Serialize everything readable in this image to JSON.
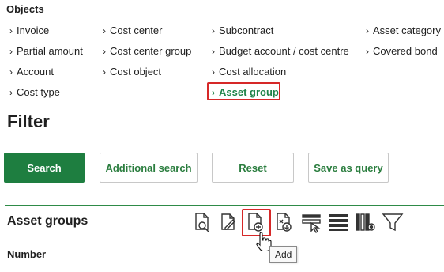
{
  "objects": {
    "title": "Objects",
    "chevron": "›",
    "links": [
      {
        "label": "Invoice"
      },
      {
        "label": "Partial amount"
      },
      {
        "label": "Account"
      },
      {
        "label": "Cost type"
      },
      {
        "label": "Cost center"
      },
      {
        "label": "Cost center group"
      },
      {
        "label": "Cost object"
      },
      {
        "label": "Subcontract"
      },
      {
        "label": "Budget account / cost centre"
      },
      {
        "label": "Cost allocation"
      },
      {
        "label": "Asset group",
        "active": true
      },
      {
        "label": "Asset category"
      },
      {
        "label": "Covered bond"
      }
    ]
  },
  "filter": {
    "title": "Filter",
    "search_label": "Search",
    "additional_search_label": "Additional search",
    "reset_label": "Reset",
    "save_query_label": "Save as query"
  },
  "grid": {
    "title": "Asset groups",
    "toolbar": [
      {
        "icon": "document-search-icon",
        "tooltip": ""
      },
      {
        "icon": "document-edit-icon",
        "tooltip": ""
      },
      {
        "icon": "document-add-icon",
        "tooltip": "Add",
        "highlighted": true
      },
      {
        "icon": "document-import-icon",
        "tooltip": ""
      },
      {
        "icon": "select-rows-icon",
        "tooltip": ""
      },
      {
        "icon": "row-height-icon",
        "tooltip": ""
      },
      {
        "icon": "column-settings-icon",
        "tooltip": ""
      },
      {
        "icon": "filter-funnel-icon",
        "tooltip": ""
      }
    ],
    "columns": [
      "Number"
    ],
    "tooltip_text": "Add"
  },
  "colors": {
    "accent_green": "#1e7e40",
    "highlight_red": "#d62828",
    "link_active": "#1e8449"
  }
}
